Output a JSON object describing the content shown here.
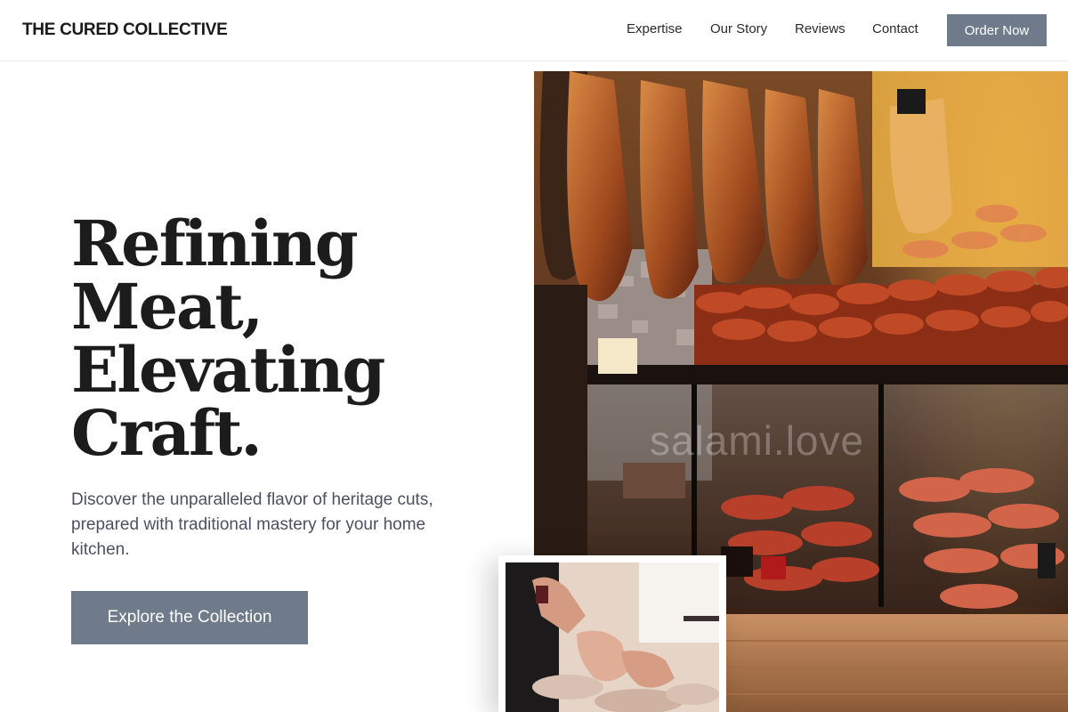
{
  "header": {
    "logo": "THE CURED COLLECTIVE",
    "nav": [
      {
        "label": "Expertise"
      },
      {
        "label": "Our Story"
      },
      {
        "label": "Reviews"
      },
      {
        "label": "Contact"
      }
    ],
    "order_button": "Order Now"
  },
  "hero": {
    "title_lines": [
      "Refining",
      "Meat,",
      "Elevating",
      "Craft."
    ],
    "description": "Discover the unparalleled flavor of heritage cuts, prepared with traditional mastery for your home kitchen.",
    "cta": "Explore the Collection"
  },
  "images": {
    "main_watermark": "salami.love",
    "main_subject": "butcher-shop-display",
    "secondary_subject": "sausage-making-hands"
  },
  "colors": {
    "accent": "#6f7b8b",
    "text_primary": "#1c1c1c",
    "text_secondary": "#4a5160"
  }
}
